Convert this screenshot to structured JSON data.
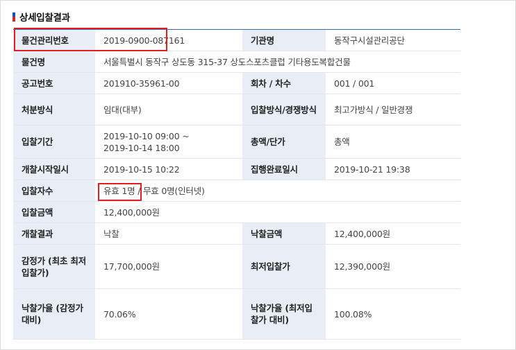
{
  "section_title": "상세입찰결과",
  "colors": {
    "header_bg": "#e9eef6",
    "top_rule": "#3a68b8",
    "highlight": "#e21d24"
  },
  "rows": {
    "item_no": {
      "label": "물건관리번호",
      "value": "2019-0900-087161"
    },
    "agency": {
      "label": "기관명",
      "value": "동작구시설관리공단"
    },
    "item_name": {
      "label": "물건명",
      "value": "서울특별시 동작구 상도동 315-37 상도스포츠클럽 기타용도복합건물"
    },
    "notice_no": {
      "label": "공고번호",
      "value": "201910-35961-00"
    },
    "round": {
      "label": "회차 / 차수",
      "value": "001 / 001"
    },
    "disposal": {
      "label": "처분방식",
      "value": "임대(대부)"
    },
    "bid_method": {
      "label": "입찰방식/경쟁방식",
      "value": "최고가방식 / 일반경쟁"
    },
    "bid_period": {
      "label": "입찰기간",
      "value_start": "2019-10-10 09:00 ~",
      "value_end": "2019-10-14 18:00"
    },
    "amount_type": {
      "label": "총액/단가",
      "value": "총액"
    },
    "open_time": {
      "label": "개찰시작일시",
      "value": "2019-10-15 10:22"
    },
    "done_time": {
      "label": "집행완료일시",
      "value": "2019-10-21 19:38"
    },
    "bidders": {
      "label": "입찰자수",
      "valid": "유효 1명",
      "rest": " / 무효 0명(인터넷)"
    },
    "bid_amount": {
      "label": "입찰금액",
      "value": "12,400,000원"
    },
    "result": {
      "label": "개찰결과",
      "value": "낙찰"
    },
    "win_amount": {
      "label": "낙찰금액",
      "value": "12,400,000원"
    },
    "appraisal": {
      "label": "감정가 (최초 최저입찰가)",
      "value": "17,700,000원"
    },
    "min_bid": {
      "label": "최저입찰가",
      "value": "12,390,000원"
    },
    "ratio_appraisal": {
      "label": "낙찰가율 (감정가 대비)",
      "value": "70.06%"
    },
    "ratio_min": {
      "label": "낙찰가율 (최저입찰가 대비)",
      "value": "100.08%"
    }
  }
}
